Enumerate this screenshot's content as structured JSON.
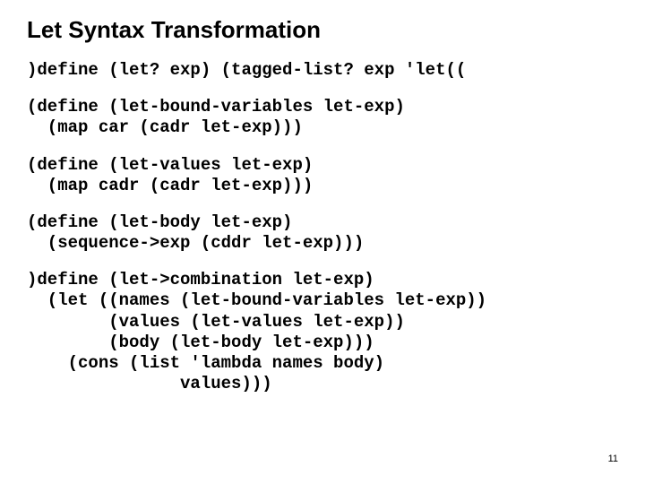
{
  "title": "Let Syntax Transformation",
  "code": {
    "block1": ")define (let? exp) (tagged-list? exp 'let((",
    "block2": "(define (let-bound-variables let-exp)\n  (map car (cadr let-exp)))",
    "block3": "(define (let-values let-exp)\n  (map cadr (cadr let-exp)))",
    "block4": "(define (let-body let-exp)\n  (sequence->exp (cddr let-exp)))",
    "block5": ")define (let->combination let-exp)\n  (let ((names (let-bound-variables let-exp))\n        (values (let-values let-exp))\n        (body (let-body let-exp)))\n    (cons (list 'lambda names body)\n               values)))"
  },
  "page_number": "11"
}
